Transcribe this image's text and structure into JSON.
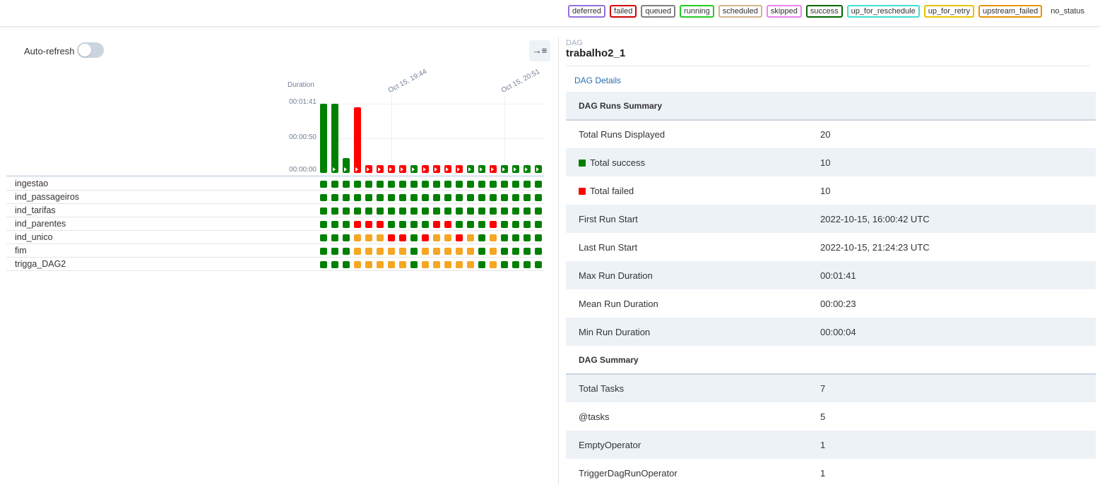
{
  "colors": {
    "success": "#008000",
    "failed": "#ff0000",
    "up_for_retry": "#f5a623",
    "legend_borders": {
      "deferred": "#9370db",
      "failed": "#d00000",
      "queued": "#808080",
      "running": "#22cc22",
      "scheduled": "#d2b48c",
      "skipped": "#ee82ee",
      "success": "#006400",
      "up_for_reschedule": "#40e0d0",
      "up_for_retry": "#e6c200",
      "upstream_failed": "#e69500"
    }
  },
  "legend": {
    "states": [
      "deferred",
      "failed",
      "queued",
      "running",
      "scheduled",
      "skipped",
      "success",
      "up_for_reschedule",
      "up_for_retry",
      "upstream_failed"
    ],
    "no_status": "no_status"
  },
  "left": {
    "auto_refresh_label": "Auto-refresh",
    "collapse_icon": "→≡"
  },
  "chart_data": {
    "type": "bar",
    "ylabel": "Duration",
    "yticks": [
      "00:00:00",
      "00:00:50",
      "00:01:41"
    ],
    "ylim_seconds": [
      0,
      101
    ],
    "x_date_labels": [
      {
        "text": "Oct 15, 19:44",
        "run_index": 6
      },
      {
        "text": "Oct 15, 20:51",
        "run_index": 16
      }
    ],
    "run_durations_seconds": [
      101,
      101,
      22,
      96,
      10,
      10,
      10,
      10,
      10,
      10,
      10,
      10,
      10,
      10,
      10,
      10,
      10,
      10,
      10,
      10
    ],
    "run_states": [
      "success",
      "success",
      "success",
      "failed",
      "failed",
      "failed",
      "failed",
      "failed",
      "success",
      "failed",
      "failed",
      "failed",
      "failed",
      "success",
      "success",
      "failed",
      "success",
      "success",
      "success",
      "success"
    ]
  },
  "tasks": [
    {
      "name": "ingestao",
      "states": [
        "s",
        "s",
        "s",
        "s",
        "s",
        "s",
        "s",
        "s",
        "s",
        "s",
        "s",
        "s",
        "s",
        "s",
        "s",
        "s",
        "s",
        "s",
        "s",
        "s"
      ]
    },
    {
      "name": "ind_passageiros",
      "states": [
        "s",
        "s",
        "s",
        "s",
        "s",
        "s",
        "s",
        "s",
        "s",
        "s",
        "s",
        "s",
        "s",
        "s",
        "s",
        "s",
        "s",
        "s",
        "s",
        "s"
      ]
    },
    {
      "name": "ind_tarifas",
      "states": [
        "s",
        "s",
        "s",
        "s",
        "s",
        "s",
        "s",
        "s",
        "s",
        "s",
        "s",
        "s",
        "s",
        "s",
        "s",
        "s",
        "s",
        "s",
        "s",
        "s"
      ]
    },
    {
      "name": "ind_parentes",
      "states": [
        "s",
        "s",
        "s",
        "f",
        "f",
        "f",
        "s",
        "s",
        "s",
        "s",
        "f",
        "f",
        "s",
        "s",
        "s",
        "f",
        "s",
        "s",
        "s",
        "s"
      ]
    },
    {
      "name": "ind_unico",
      "states": [
        "s",
        "s",
        "s",
        "r",
        "r",
        "r",
        "f",
        "f",
        "s",
        "f",
        "r",
        "r",
        "f",
        "r",
        "s",
        "r",
        "s",
        "s",
        "s",
        "s"
      ]
    },
    {
      "name": "fim",
      "states": [
        "s",
        "s",
        "s",
        "r",
        "r",
        "r",
        "r",
        "r",
        "s",
        "r",
        "r",
        "r",
        "r",
        "r",
        "s",
        "r",
        "s",
        "s",
        "s",
        "s"
      ]
    },
    {
      "name": "trigga_DAG2",
      "states": [
        "s",
        "s",
        "s",
        "r",
        "r",
        "r",
        "r",
        "r",
        "s",
        "r",
        "r",
        "r",
        "r",
        "r",
        "s",
        "r",
        "s",
        "s",
        "s",
        "s"
      ]
    }
  ],
  "right": {
    "dag_small": "DAG",
    "dag_title": "trabalho2_1",
    "details_link": "DAG Details",
    "runs_summary_title": "DAG Runs Summary",
    "rows_runs": [
      {
        "label": "Total Runs Displayed",
        "value": "20"
      },
      {
        "label": "Total success",
        "value": "10",
        "swatch": "success"
      },
      {
        "label": "Total failed",
        "value": "10",
        "swatch": "failed"
      },
      {
        "label": "First Run Start",
        "value": "2022-10-15, 16:00:42 UTC"
      },
      {
        "label": "Last Run Start",
        "value": "2022-10-15, 21:24:23 UTC"
      },
      {
        "label": "Max Run Duration",
        "value": "00:01:41"
      },
      {
        "label": "Mean Run Duration",
        "value": "00:00:23"
      },
      {
        "label": "Min Run Duration",
        "value": "00:00:04"
      }
    ],
    "dag_summary_title": "DAG Summary",
    "rows_dag": [
      {
        "label": "Total Tasks",
        "value": "7"
      },
      {
        "label": "@tasks",
        "value": "5"
      },
      {
        "label": "EmptyOperator",
        "value": "1"
      },
      {
        "label": "TriggerDagRunOperator",
        "value": "1"
      }
    ]
  }
}
